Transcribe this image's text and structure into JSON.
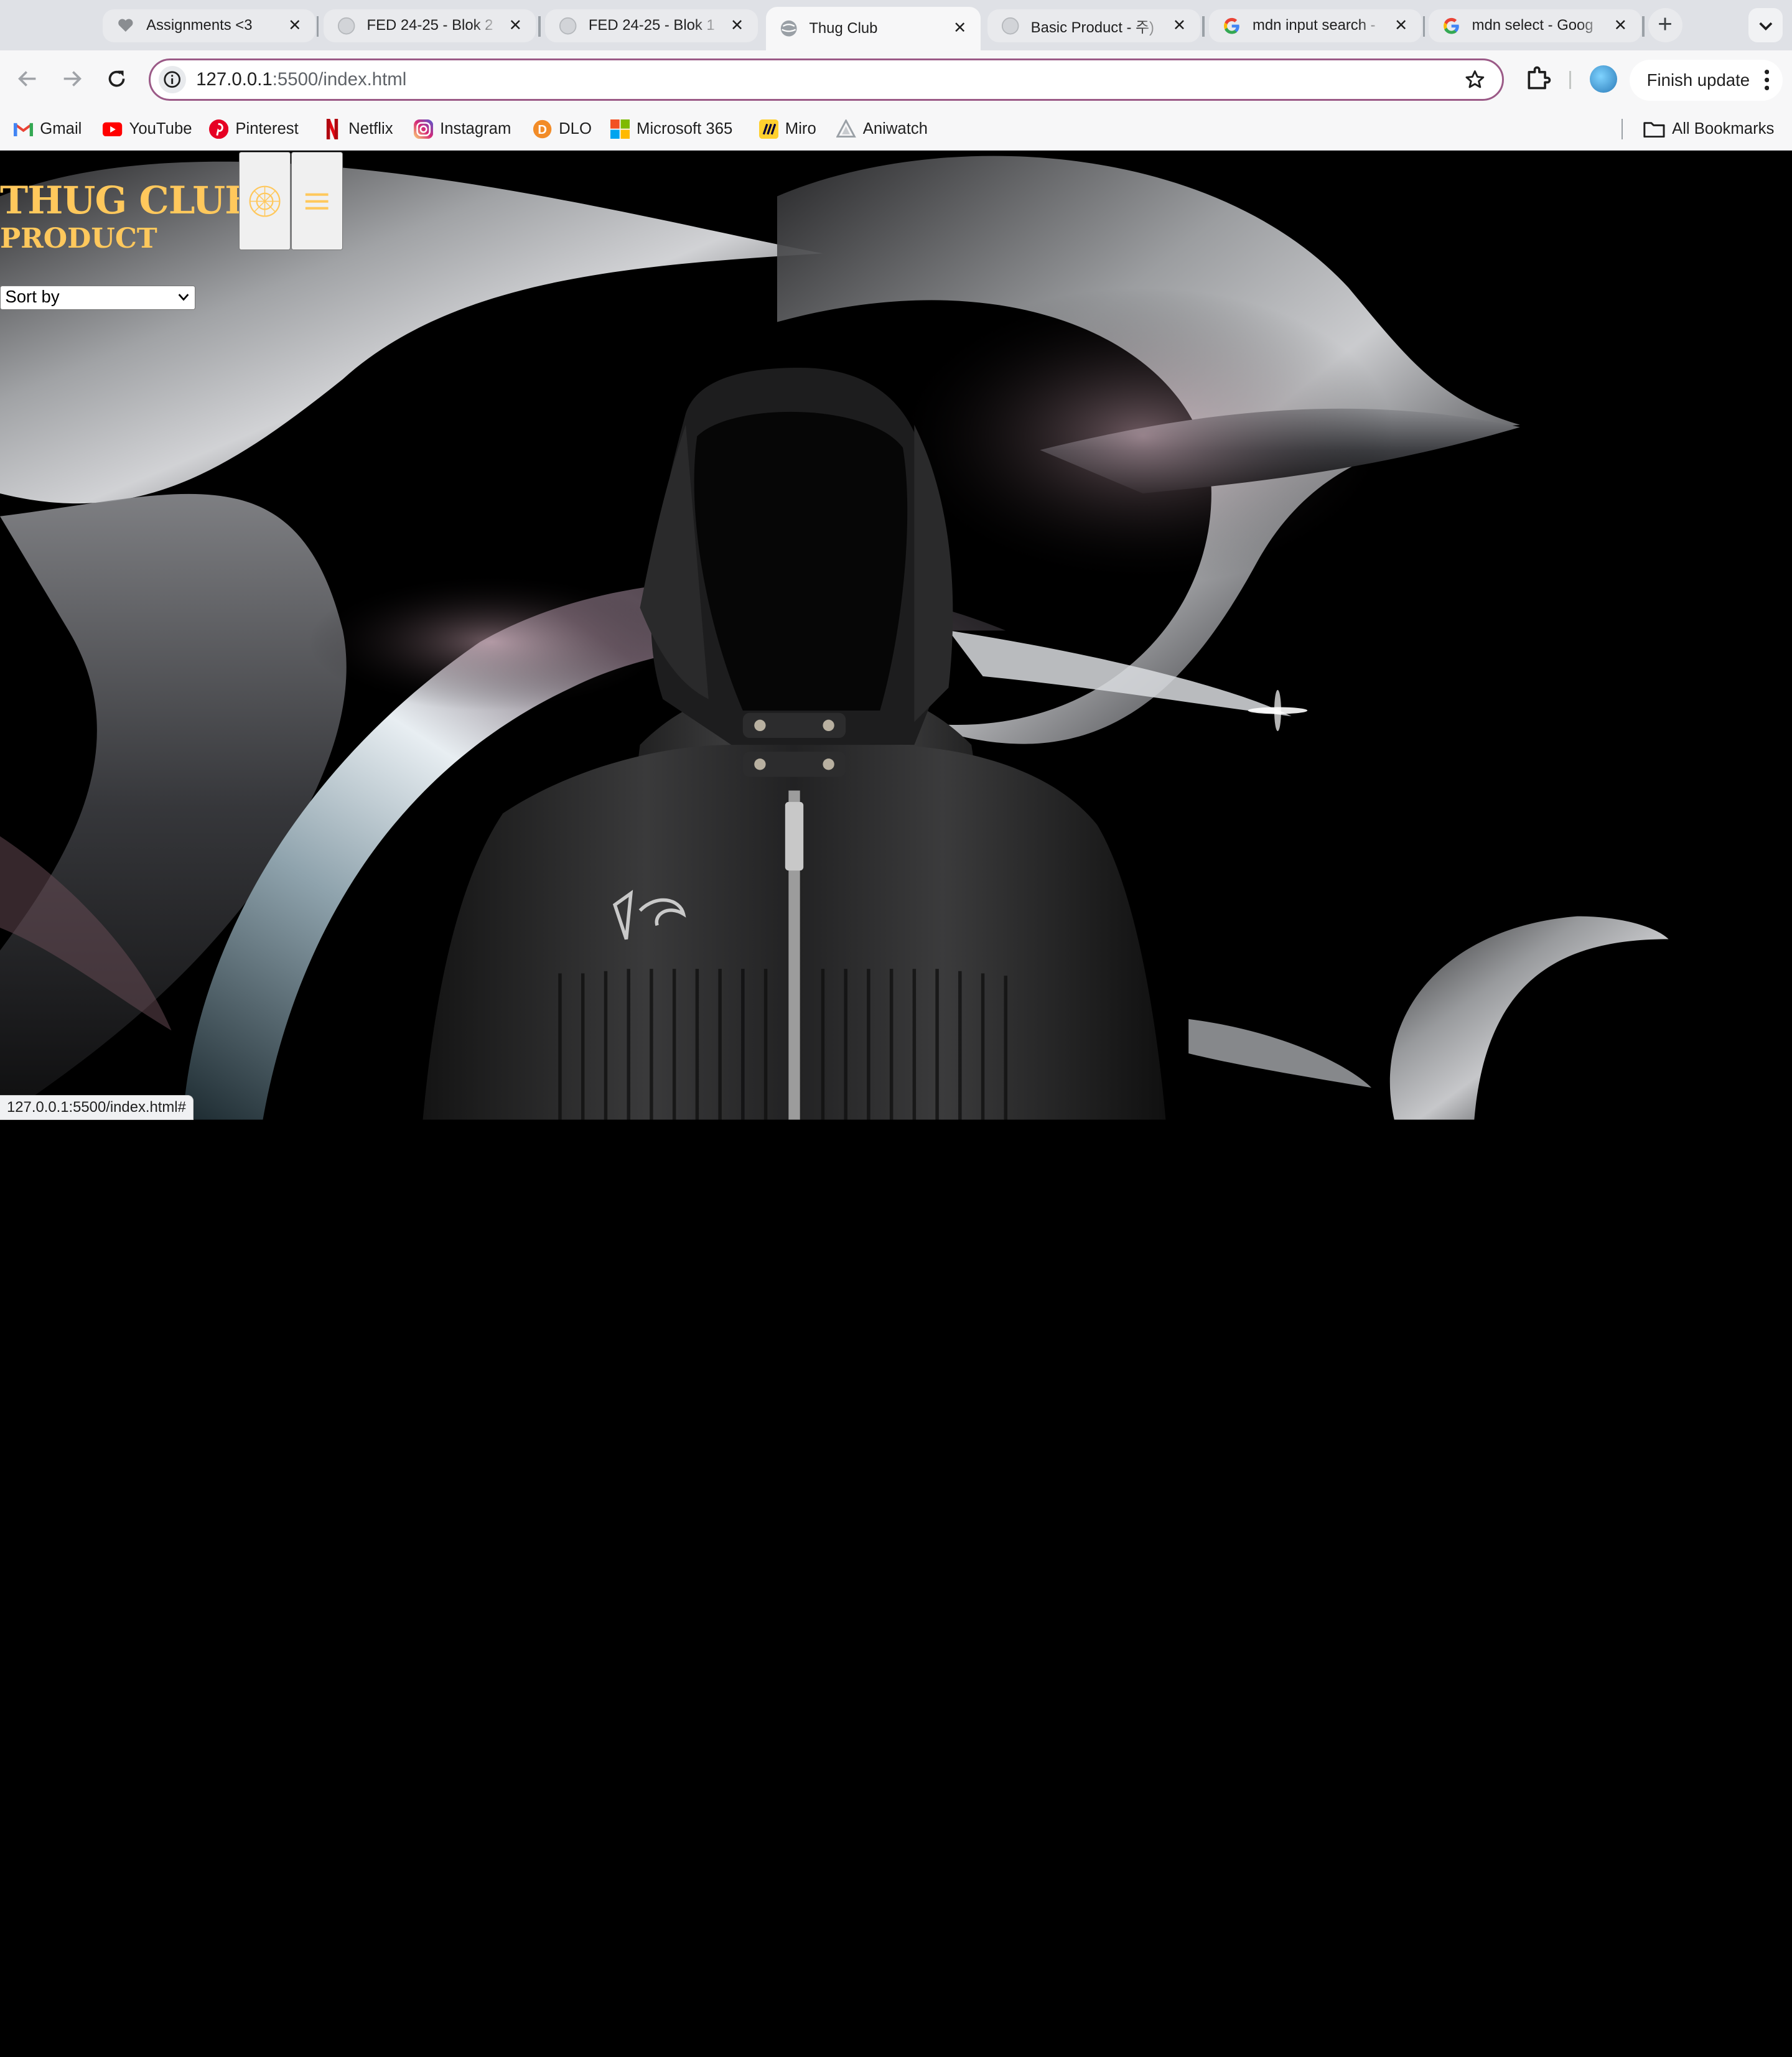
{
  "browser": {
    "tabs": [
      {
        "title": "Assignments <3",
        "icon": "heart-icon",
        "active": false
      },
      {
        "title": "FED 24-25 - Blok 2",
        "icon": "globe-icon",
        "active": false
      },
      {
        "title": "FED 24-25 - Blok 1",
        "icon": "globe-icon",
        "active": false
      },
      {
        "title": "Thug Club",
        "icon": "globe-icon",
        "active": true
      },
      {
        "title": "Basic Product - 주)",
        "icon": "globe-icon",
        "active": false
      },
      {
        "title": "mdn input search -",
        "icon": "google-icon",
        "active": false
      },
      {
        "title": "mdn select - Goog",
        "icon": "google-icon",
        "active": false
      }
    ],
    "address": {
      "host": "127.0.0.1",
      "path": ":5500/index.html"
    },
    "update_label": "Finish update",
    "bookmarks": [
      {
        "label": "Gmail",
        "icon": "gmail-icon"
      },
      {
        "label": "YouTube",
        "icon": "youtube-icon"
      },
      {
        "label": "Pinterest",
        "icon": "pinterest-icon"
      },
      {
        "label": "Netflix",
        "icon": "netflix-icon"
      },
      {
        "label": "Instagram",
        "icon": "instagram-icon"
      },
      {
        "label": "DLO",
        "icon": "dlo-icon"
      },
      {
        "label": "Microsoft 365",
        "icon": "microsoft-icon"
      },
      {
        "label": "Miro",
        "icon": "miro-icon"
      },
      {
        "label": "Aniwatch",
        "icon": "aniwatch-icon"
      }
    ],
    "all_bookmarks_label": "All Bookmarks",
    "status_url": "127.0.0.1:5500/index.html#"
  },
  "site": {
    "brand": "THUG CLUB",
    "section": "PRODUCT",
    "sort_select": {
      "selected": "Sort by"
    },
    "accent_color": "#ffc85c"
  }
}
